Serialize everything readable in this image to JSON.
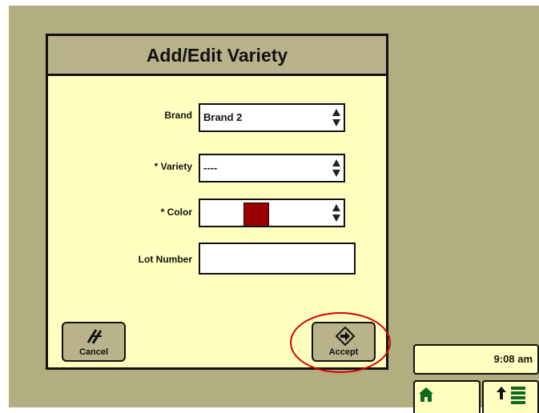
{
  "dialog": {
    "title": "Add/Edit Variety",
    "fields": [
      {
        "label": "Brand",
        "value": "Brand 2"
      },
      {
        "label": "* Variety",
        "value": "----"
      },
      {
        "label": "* Color",
        "value": ""
      },
      {
        "label": "Lot Number",
        "value": ""
      }
    ],
    "color_value": "#9b0000",
    "cancel_label": "Cancel",
    "accept_label": "Accept"
  },
  "status": {
    "time": "9:08 am"
  },
  "softkeys": {
    "home_icon": "home-icon",
    "rows_icon": "up-arrow-rows-icon"
  },
  "colors": {
    "background": "#b1ae80",
    "dialog_bg": "#ffffc0",
    "title_bar": "#b8b38a",
    "highlight": "#d40000"
  }
}
